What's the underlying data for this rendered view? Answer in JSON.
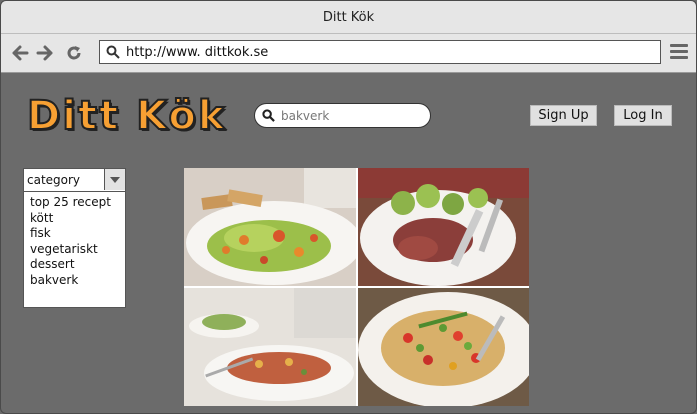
{
  "window": {
    "title": "Ditt Kök"
  },
  "browser": {
    "url": "http://www. dittkok.se"
  },
  "header": {
    "logo_text": "Ditt Kök",
    "search": {
      "value": "",
      "placeholder": "bakverk"
    },
    "signup_label": "Sign Up",
    "login_label": "Log In"
  },
  "sidebar": {
    "category_label": "category",
    "items": [
      {
        "label": "top 25 recept"
      },
      {
        "label": "kött"
      },
      {
        "label": "fisk"
      },
      {
        "label": "vegetariskt"
      },
      {
        "label": "dessert"
      },
      {
        "label": "bakverk"
      }
    ]
  },
  "gallery": {
    "images": [
      {
        "name": "salad-with-bread"
      },
      {
        "name": "steak-with-sprouts"
      },
      {
        "name": "pasta-dish"
      },
      {
        "name": "vegetable-pasta"
      }
    ]
  },
  "colors": {
    "logo": "#f7a033",
    "page_bg": "#6b6b6b"
  }
}
